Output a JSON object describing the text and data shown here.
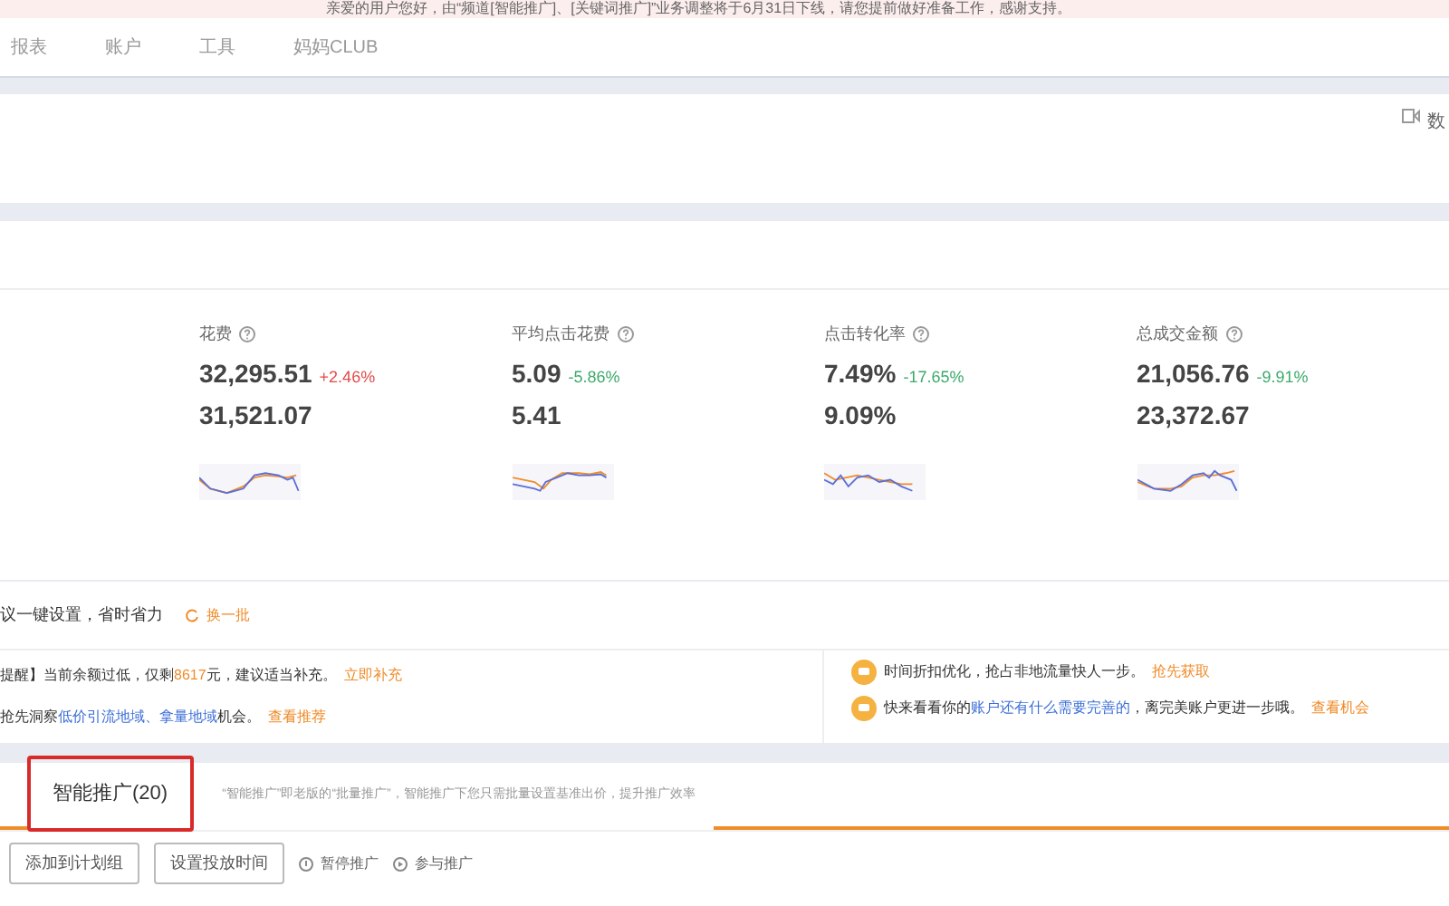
{
  "banner": {
    "text": "亲爱的用户您好，由“频道[智能推广]、[关键词推广]”业务调整将于6月31日下线，请您提前做好准备工作，感谢支持。"
  },
  "nav": {
    "items": [
      {
        "label": "报表",
        "selected": false
      },
      {
        "label": "账户",
        "selected": false
      },
      {
        "label": "工具",
        "selected": false
      },
      {
        "label": "妈妈CLUB",
        "selected": false
      }
    ]
  },
  "panel_top": {
    "right_label": "数"
  },
  "metrics": [
    {
      "label": "花费",
      "value": "32,295.51",
      "change": "+2.46%",
      "color": "#e24b4b",
      "previous": "31,521.07"
    },
    {
      "label": "平均点击花费",
      "value": "5.09",
      "change": "-5.86%",
      "color": "#3daa6b",
      "previous": "5.41"
    },
    {
      "label": "点击转化率",
      "value": "7.49%",
      "change": "-17.65%",
      "color": "#3daa6b",
      "previous": "9.09%"
    },
    {
      "label": "总成交金额",
      "value": "21,056.76",
      "change": "-9.91%",
      "color": "#3daa6b",
      "previous": "23,372.67"
    }
  ],
  "suggestions": {
    "title": "议一键设置，省时省力",
    "refresh": "换一批",
    "left": [
      [
        {
          "kind": "text",
          "text": "提醒】当前余额过低，仅剩"
        },
        {
          "kind": "highlight",
          "text": "8617"
        },
        {
          "kind": "text",
          "text": "元，建议适当补充。"
        },
        {
          "kind": "action",
          "text": "立即补充"
        }
      ],
      [
        {
          "kind": "text",
          "text": "抢先洞察"
        },
        {
          "kind": "link",
          "text": "低价引流地域、拿量地域"
        },
        {
          "kind": "text",
          "text": "机会。"
        },
        {
          "kind": "action",
          "text": "查看推荐"
        }
      ]
    ],
    "right": [
      [
        {
          "kind": "text",
          "text": "时间折扣优化，抢占非地流量快人一步。"
        },
        {
          "kind": "action",
          "text": "抢先获取"
        }
      ],
      [
        {
          "kind": "text",
          "text": "快来看看你的"
        },
        {
          "kind": "link",
          "text": "账户还有什么需要完善的"
        },
        {
          "kind": "text",
          "text": "，离完美账户更进一步哦。"
        },
        {
          "kind": "action",
          "text": "查看机会"
        }
      ]
    ]
  },
  "tabs": [
    {
      "label": "智能推广(20)",
      "selected": true,
      "highlighted": true
    }
  ],
  "tab_note": "“智能推广”即老版的“批量推广”，智能推广下您只需批量设置基准出价，提升推广效率",
  "actions": [
    {
      "kind": "button",
      "label": "添加到计划组"
    },
    {
      "kind": "button",
      "label": "设置投放时间"
    },
    {
      "kind": "pause",
      "label": "暂停推广"
    },
    {
      "kind": "play",
      "label": "参与推广"
    }
  ]
}
